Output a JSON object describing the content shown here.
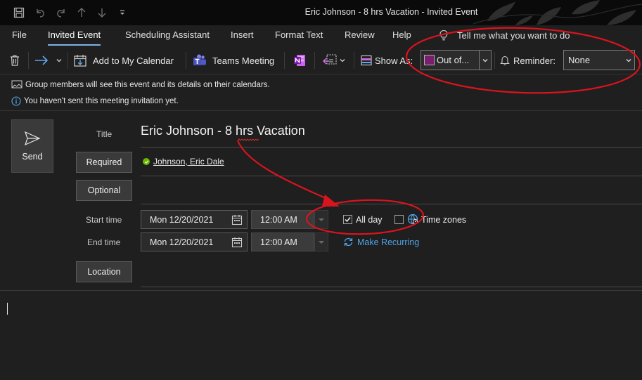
{
  "window": {
    "title": "Eric Johnson - 8 hrs Vacation  -  Invited Event"
  },
  "quick_access": [
    "save-icon",
    "undo-icon",
    "redo-icon",
    "up-arrow-icon",
    "down-arrow-icon",
    "customize-icon"
  ],
  "ribbon": {
    "tabs": [
      {
        "label": "File",
        "active": false
      },
      {
        "label": "Invited Event",
        "active": true
      },
      {
        "label": "Scheduling Assistant",
        "active": false
      },
      {
        "label": "Insert",
        "active": false
      },
      {
        "label": "Format Text",
        "active": false
      },
      {
        "label": "Review",
        "active": false
      },
      {
        "label": "Help",
        "active": false
      }
    ],
    "tell_me": "Tell me what you want to do"
  },
  "toolbar": {
    "add_to_calendar": "Add to My Calendar",
    "teams_meeting": "Teams Meeting",
    "show_as_label": "Show As:",
    "show_as_value": "Out of...",
    "reminder_label": "Reminder:",
    "reminder_value": "None"
  },
  "info": {
    "group_notice": "Group members will see this event and its details on their calendars.",
    "not_sent_notice": "You haven't sent this meeting invitation yet."
  },
  "form": {
    "send_label": "Send",
    "title_label": "Title",
    "title_value": "Eric Johnson - 8 hrs Vacation",
    "required_button": "Required",
    "optional_button": "Optional",
    "attendee": "Johnson, Eric Dale",
    "start_label": "Start time",
    "start_date": "Mon 12/20/2021",
    "start_time": "12:00 AM",
    "end_label": "End time",
    "end_date": "Mon 12/20/2021",
    "end_time": "12:00 AM",
    "all_day_label": "All day",
    "all_day_checked": true,
    "time_zones_label": "Time zones",
    "time_zones_checked": false,
    "make_recurring": "Make Recurring",
    "location_button": "Location"
  },
  "colors": {
    "annotation": "#d9141e",
    "accent_link": "#4fa3e6",
    "show_as_swatch": "#7a1f6e",
    "attendee_status": "#6bb700"
  }
}
